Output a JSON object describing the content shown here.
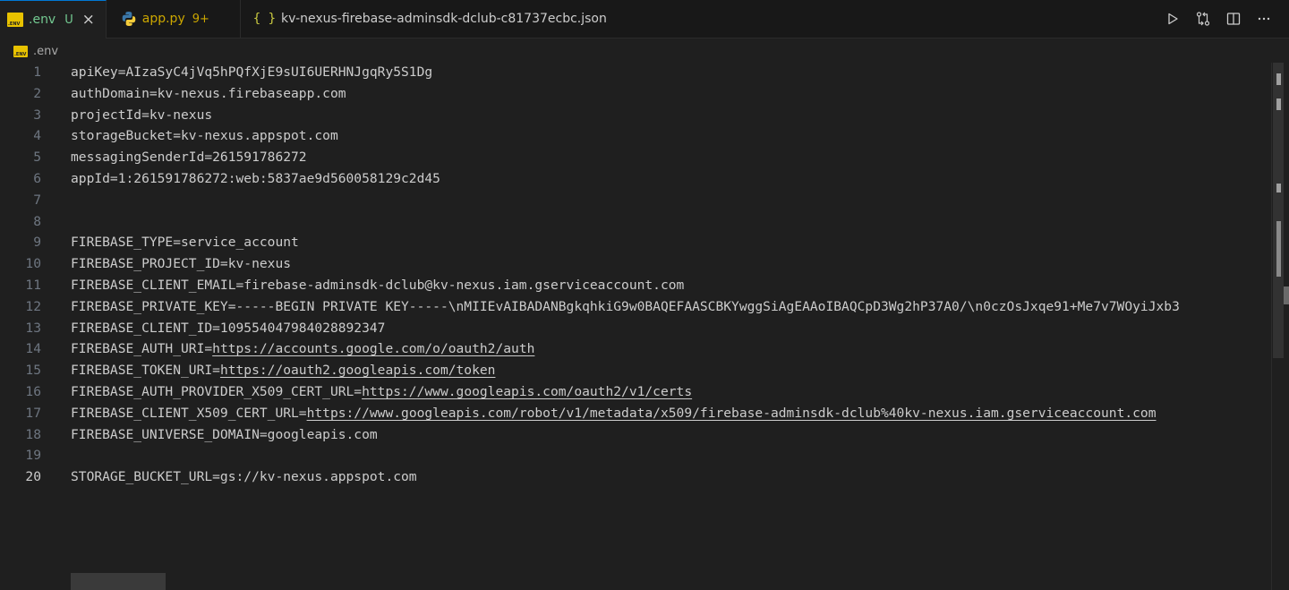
{
  "tabs": [
    {
      "name": ".env",
      "badge": "U",
      "close": "×"
    },
    {
      "name": "app.py",
      "badge": "9+"
    },
    {
      "name": "kv-nexus-firebase-adminsdk-dclub-c81737ecbc.json",
      "icon": "{ }"
    }
  ],
  "breadcrumb": {
    "file": ".env"
  },
  "editor": {
    "lines": [
      {
        "n": "1",
        "text": "apiKey=AIzaSyC4jVq5hPQfXjE9sUI6UERHNJgqRy5S1Dg"
      },
      {
        "n": "2",
        "text": "authDomain=kv-nexus.firebaseapp.com"
      },
      {
        "n": "3",
        "text": "projectId=kv-nexus"
      },
      {
        "n": "4",
        "text": "storageBucket=kv-nexus.appspot.com"
      },
      {
        "n": "5",
        "text": "messagingSenderId=261591786272"
      },
      {
        "n": "6",
        "text": "appId=1:261591786272:web:5837ae9d560058129c2d45"
      },
      {
        "n": "7",
        "text": ""
      },
      {
        "n": "8",
        "text": ""
      },
      {
        "n": "9",
        "text": "FIREBASE_TYPE=service_account"
      },
      {
        "n": "10",
        "text": "FIREBASE_PROJECT_ID=kv-nexus"
      },
      {
        "n": "11",
        "text": "FIREBASE_CLIENT_EMAIL=firebase-adminsdk-dclub@kv-nexus.iam.gserviceaccount.com"
      },
      {
        "n": "12",
        "text": "FIREBASE_PRIVATE_KEY=-----BEGIN PRIVATE KEY-----\\nMIIEvAIBADANBgkqhkiG9w0BAQEFAASCBKYwggSiAgEAAoIBAQCpD3Wg2hP37A0/\\n0czOsJxqe91+Me7v7WOyiJxb3"
      },
      {
        "n": "13",
        "text": "FIREBASE_CLIENT_ID=109554047984028892347"
      },
      {
        "n": "14",
        "key": "FIREBASE_AUTH_URI=",
        "url": "https://accounts.google.com/o/oauth2/auth"
      },
      {
        "n": "15",
        "key": "FIREBASE_TOKEN_URI=",
        "url": "https://oauth2.googleapis.com/token"
      },
      {
        "n": "16",
        "key": "FIREBASE_AUTH_PROVIDER_X509_CERT_URL=",
        "url": "https://www.googleapis.com/oauth2/v1/certs"
      },
      {
        "n": "17",
        "key": "FIREBASE_CLIENT_X509_CERT_URL=",
        "url": "https://www.googleapis.com/robot/v1/metadata/x509/firebase-adminsdk-dclub%40kv-nexus.iam.gserviceaccount.com"
      },
      {
        "n": "18",
        "text": "FIREBASE_UNIVERSE_DOMAIN=googleapis.com"
      },
      {
        "n": "19",
        "text": ""
      },
      {
        "n": "20",
        "text": "STORAGE_BUCKET_URL=gs://kv-nexus.appspot.com"
      }
    ]
  },
  "icons": {
    "run": "play-icon",
    "compare": "compare-changes-icon",
    "split": "split-editor-icon",
    "more": "more-actions-icon"
  }
}
